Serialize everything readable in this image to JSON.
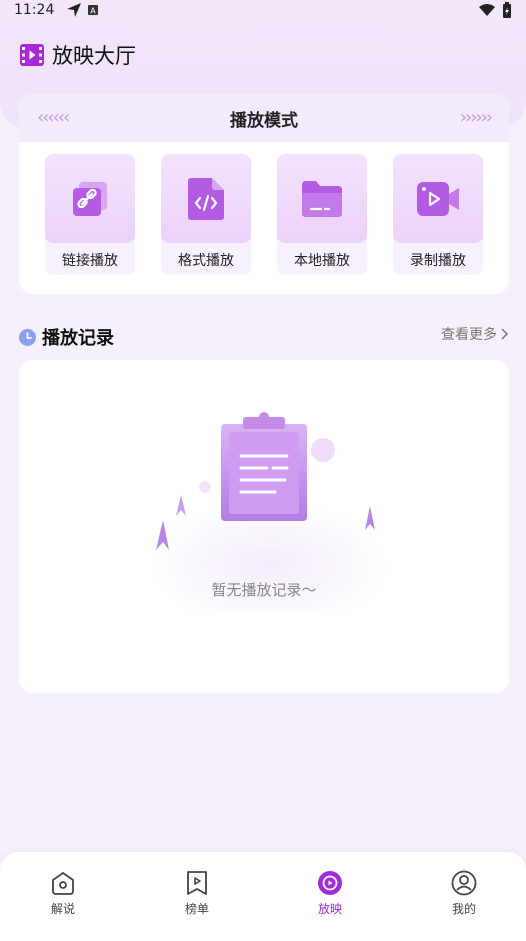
{
  "status": {
    "time": "11:24"
  },
  "header": {
    "title": "放映大厅"
  },
  "modes": {
    "title": "播放模式",
    "items": [
      {
        "label": "链接播放",
        "icon": "link-icon"
      },
      {
        "label": "格式播放",
        "icon": "code-file-icon"
      },
      {
        "label": "本地播放",
        "icon": "folder-icon"
      },
      {
        "label": "录制播放",
        "icon": "video-camera-icon"
      }
    ]
  },
  "records": {
    "title": "播放记录",
    "more": "查看更多",
    "empty": "暂无播放记录～"
  },
  "tabbar": {
    "items": [
      {
        "label": "解说",
        "icon": "home-icon"
      },
      {
        "label": "榜单",
        "icon": "bookmark-play-icon"
      },
      {
        "label": "放映",
        "icon": "play-circle-icon",
        "active": true
      },
      {
        "label": "我的",
        "icon": "user-icon"
      }
    ]
  },
  "colors": {
    "accent": "#9c2bd6",
    "icon_purple": "#b35be3",
    "background": "#f6f0fb"
  }
}
